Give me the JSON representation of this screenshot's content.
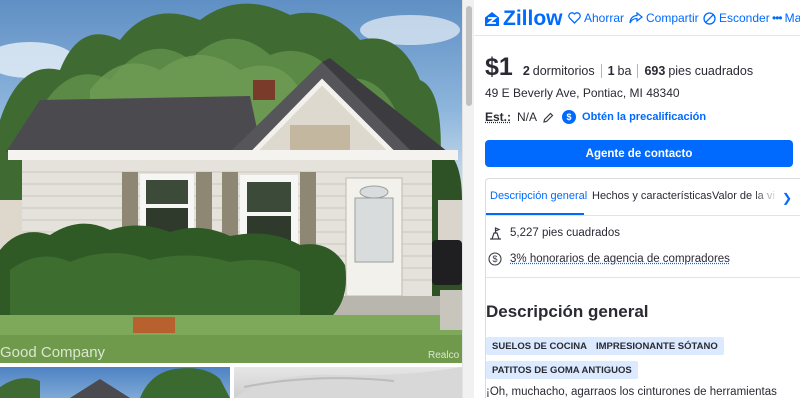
{
  "photos": {
    "watermark_left": "Good Company",
    "watermark_right": "Realco"
  },
  "header": {
    "logo_text": "Zillow",
    "save_label": "Ahorrar",
    "share_label": "Compartir",
    "hide_label": "Esconder",
    "more_label": "Ma"
  },
  "listing": {
    "price": "$1",
    "beds_value": "2",
    "beds_label": "dormitorios",
    "baths_value": "1",
    "baths_label": "ba",
    "sqft_value": "693",
    "sqft_label": "pies cuadrados",
    "address": "49 E Beverly Ave,  Pontiac, MI 48340",
    "est_label": "Est.:",
    "est_value": "N/A",
    "prequal_link": "Obtén la precalificación",
    "contact_button": "Agente de contacto"
  },
  "tabs": [
    {
      "label": "Descripción general",
      "active": true
    },
    {
      "label": "Hechos y características",
      "active": false
    },
    {
      "label": "Valor de la vi",
      "active": false
    }
  ],
  "details": {
    "lot_size": "5,227 pies cuadrados",
    "commission": "3% honorarios de agencia de compradores"
  },
  "description": {
    "title": "Descripción general",
    "tags": [
      "SUELOS DE COCINA",
      "IMPRESIONANTE SÓTANO",
      "PATITOS DE GOMA ANTIGUOS"
    ],
    "text": "¡Oh, muchacho, agarraos los cinturones de herramientas"
  },
  "colors": {
    "brand": "#006aff",
    "tag_bg": "#dbeafe",
    "text": "#2a2a33"
  }
}
